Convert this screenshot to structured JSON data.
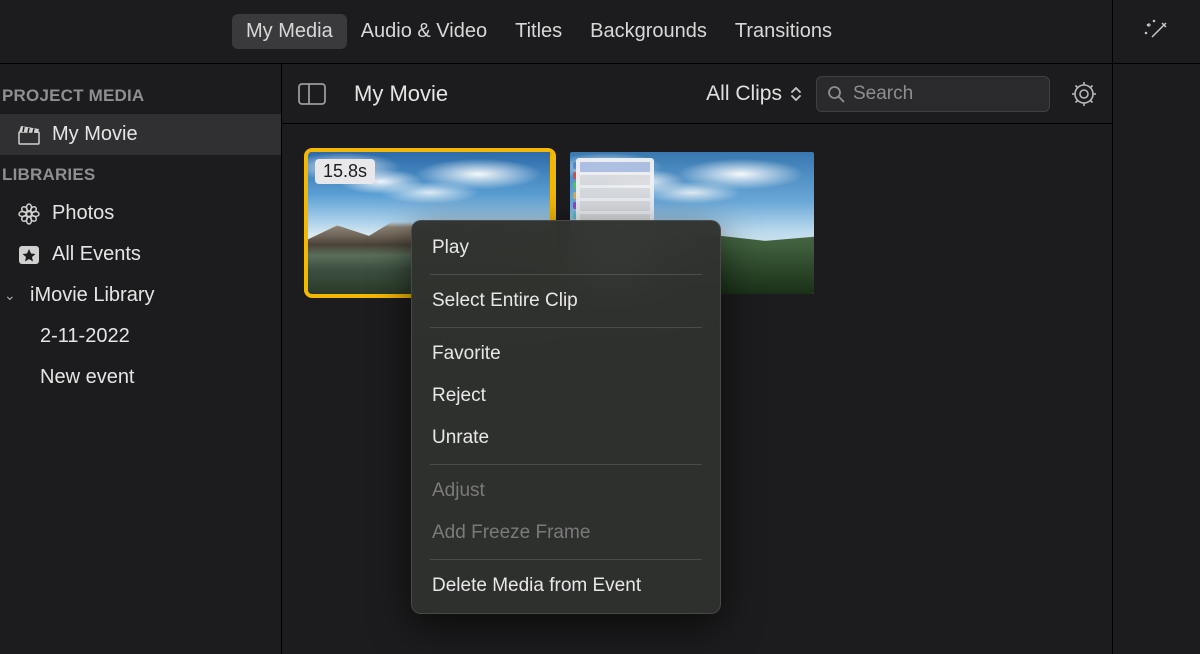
{
  "header": {
    "tabs": [
      {
        "label": "My Media",
        "active": true
      },
      {
        "label": "Audio & Video"
      },
      {
        "label": "Titles"
      },
      {
        "label": "Backgrounds"
      },
      {
        "label": "Transitions"
      }
    ]
  },
  "sidebar": {
    "sections": {
      "project_media": {
        "header": "PROJECT MEDIA",
        "items": [
          {
            "label": "My Movie",
            "icon": "clapperboard-icon",
            "active": true
          }
        ]
      },
      "libraries": {
        "header": "LIBRARIES",
        "items": [
          {
            "label": "Photos",
            "icon": "flower-icon"
          },
          {
            "label": "All Events",
            "icon": "star-box-icon"
          },
          {
            "label": "iMovie Library",
            "icon": "disclosure-icon",
            "expanded": true,
            "children": [
              {
                "label": "2-11-2022"
              },
              {
                "label": "New event"
              }
            ]
          }
        ]
      }
    }
  },
  "toolbar": {
    "project_title": "My Movie",
    "filter_label": "All Clips",
    "search_placeholder": "Search"
  },
  "clips": [
    {
      "duration_label": "15.8s",
      "selected": true
    },
    {
      "selected": false
    }
  ],
  "context_menu": {
    "groups": [
      [
        {
          "label": "Play"
        }
      ],
      [
        {
          "label": "Select Entire Clip"
        }
      ],
      [
        {
          "label": "Favorite"
        },
        {
          "label": "Reject"
        },
        {
          "label": "Unrate"
        }
      ],
      [
        {
          "label": "Adjust",
          "disabled": true
        },
        {
          "label": "Add Freeze Frame",
          "disabled": true
        }
      ],
      [
        {
          "label": "Delete Media from Event"
        }
      ]
    ]
  }
}
